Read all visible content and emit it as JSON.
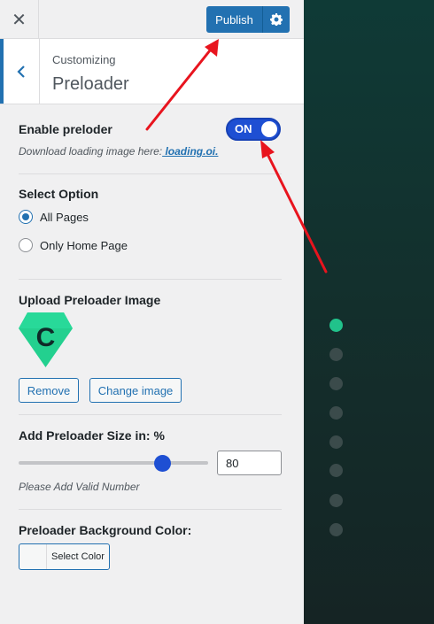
{
  "topbar": {
    "close_label": "✕",
    "publish_label": "Publish",
    "settings_icon": "gear-icon"
  },
  "header": {
    "back_icon": "chevron-left-icon",
    "crumb": "Customizing",
    "title": "Preloader"
  },
  "preloader": {
    "enable_label": "Enable preloder",
    "toggle_state": "ON",
    "download_text": "Download loading image here:",
    "download_link": " loading.oi."
  },
  "select_option": {
    "label": "Select Option",
    "options": [
      "All Pages",
      "Only Home Page"
    ],
    "selected": "All Pages"
  },
  "upload": {
    "label": "Upload Preloader Image",
    "image_letter": "C",
    "remove_label": "Remove",
    "change_label": "Change image"
  },
  "size": {
    "label": "Add Preloader Size in: %",
    "value": "80",
    "slider_fraction": 0.76,
    "hint": "Please Add Valid Number"
  },
  "bg_color": {
    "label": "Preloader Background Color:",
    "button_label": "Select Color"
  },
  "preview": {
    "dot_count": 8,
    "active_dot": 0,
    "active_color": "#21c28b"
  },
  "colors": {
    "accent": "#2271b1",
    "toggle": "#1e4fd3",
    "annotation": "#e8141e"
  }
}
